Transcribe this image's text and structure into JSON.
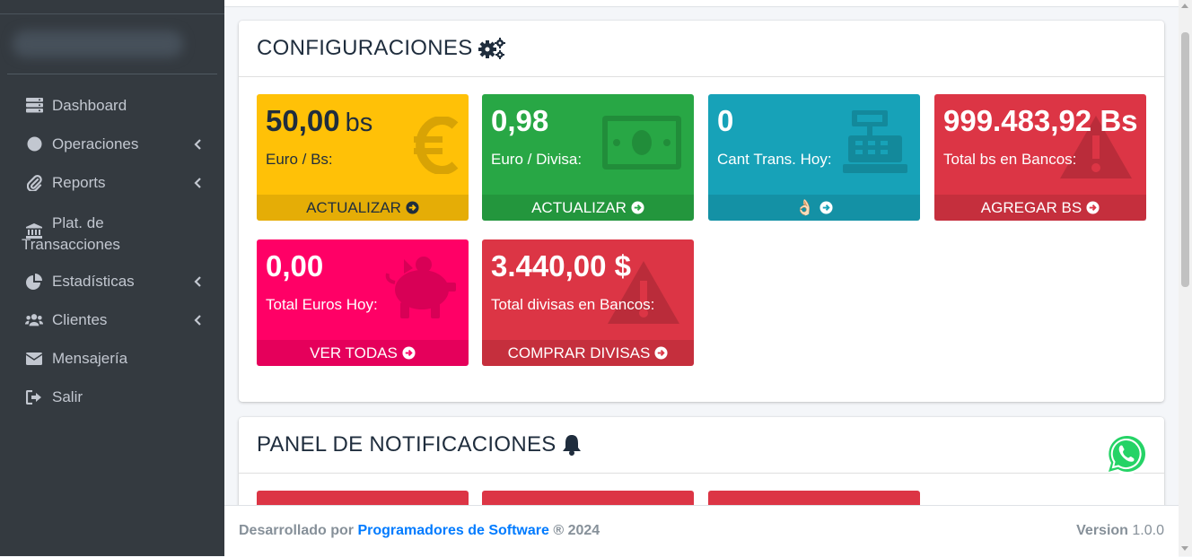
{
  "sidebar": {
    "items": [
      {
        "label": "Dashboard",
        "icon": "server-icon",
        "has_submenu": false
      },
      {
        "label": "Operaciones",
        "icon": "circle-icon",
        "has_submenu": true
      },
      {
        "label": "Reports",
        "icon": "paperclip-icon",
        "has_submenu": true
      },
      {
        "label": "Plat. de",
        "label2": "Transacciones",
        "icon": "bank-icon",
        "has_submenu": false
      },
      {
        "label": "Estadísticas",
        "icon": "pie-chart-icon",
        "has_submenu": true
      },
      {
        "label": "Clientes",
        "icon": "users-icon",
        "has_submenu": true
      },
      {
        "label": "Mensajería",
        "icon": "envelope-icon",
        "has_submenu": false
      },
      {
        "label": "Salir",
        "icon": "sign-out-icon",
        "has_submenu": false
      }
    ]
  },
  "config": {
    "title": "CONFIGURACIONES",
    "title_icon": "cogs-icon",
    "boxes": [
      {
        "value": "50,00",
        "unit": "bs",
        "label": "Euro / Bs:",
        "footer": "ACTUALIZAR",
        "color": "#ffc107",
        "icon": "euro-icon"
      },
      {
        "value": "0,98",
        "label": "Euro / Divisa:",
        "footer": "ACTUALIZAR",
        "color": "#28a745",
        "icon": "money-bill-icon"
      },
      {
        "value": "0",
        "label": "Cant Trans. Hoy:",
        "footer": "👌🏻",
        "color": "#17a2b8",
        "icon": "cash-register-icon"
      },
      {
        "value": "999.483,92 Bs",
        "label": "Total bs en Bancos:",
        "footer": "AGREGAR BS",
        "color": "#dc3545",
        "icon": "warning-icon"
      },
      {
        "value": "0,00",
        "label": "Total Euros Hoy:",
        "footer": "VER TODAS",
        "color": "#ff0066",
        "icon": "piggy-bank-icon"
      },
      {
        "value": "3.440,00 $",
        "label": "Total divisas en Bancos:",
        "footer": "COMPRAR DIVISAS",
        "color": "#dc3545",
        "icon": "warning-icon"
      }
    ]
  },
  "notifications": {
    "title": "PANEL DE NOTIFICACIONES",
    "title_icon": "bell-icon"
  },
  "footer": {
    "prefix": "Desarrollado por",
    "company": "Programadores de Software",
    "suffix": "® 2024",
    "version_label": "Version",
    "version": "1.0.0"
  },
  "whatsapp_icon": "whatsapp-icon"
}
